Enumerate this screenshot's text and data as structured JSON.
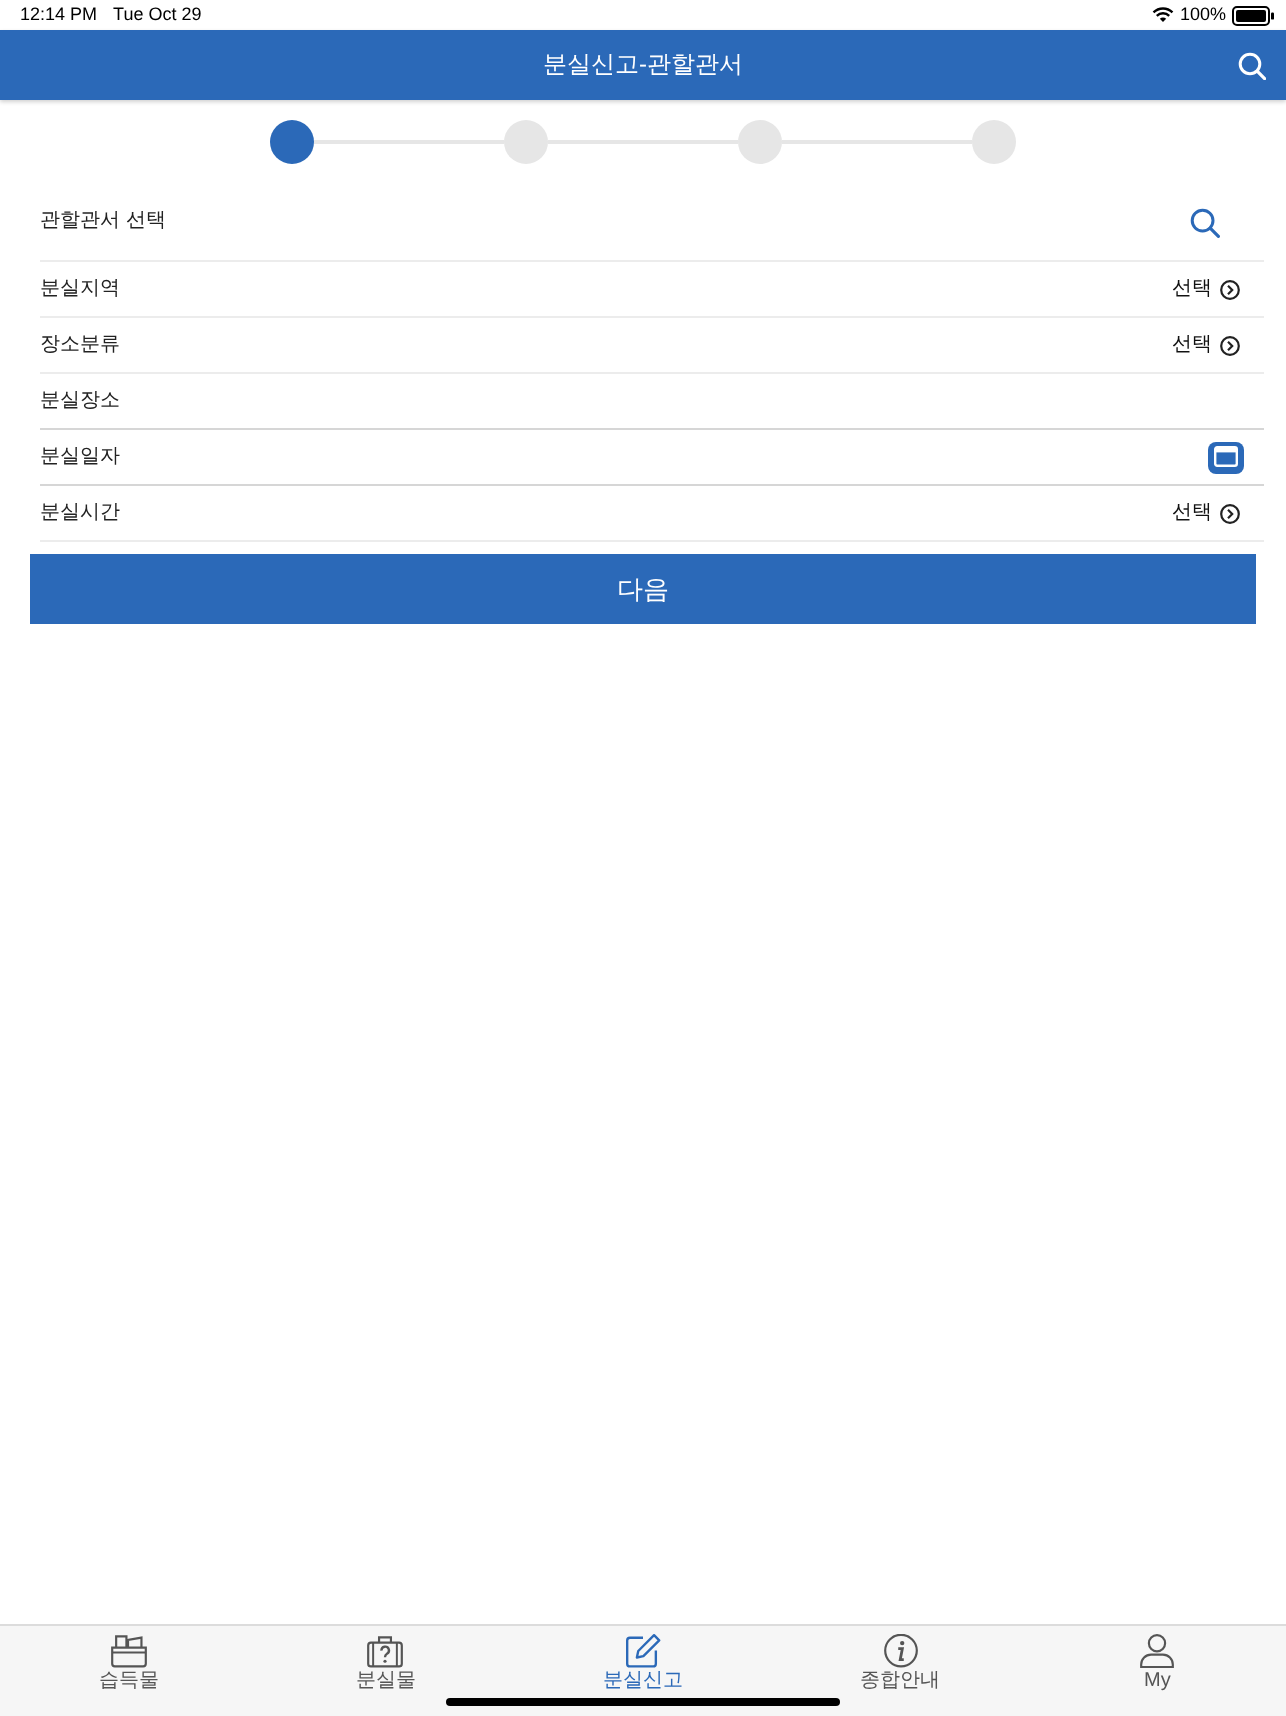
{
  "status_bar": {
    "time": "12:14 PM",
    "date": "Tue Oct 29",
    "battery": "100%"
  },
  "nav_bar": {
    "title": "분실신고-관할관서"
  },
  "steps": [
    {
      "selected": true
    },
    {
      "selected": false
    },
    {
      "selected": false
    },
    {
      "selected": false
    }
  ],
  "form_rows": [
    {
      "kind": "search",
      "label": "관할관서 선택"
    },
    {
      "kind": "select",
      "label": "분실지역",
      "action": "선택"
    },
    {
      "kind": "select",
      "label": "장소분류",
      "action": "선택"
    },
    {
      "kind": "text",
      "label": "분실장소"
    },
    {
      "kind": "date",
      "label": "분실일자"
    },
    {
      "kind": "select",
      "label": "분실시간",
      "action": "선택"
    }
  ],
  "next_button": {
    "label": "다음"
  },
  "tab_bar": [
    {
      "label": "습득물",
      "selected": false
    },
    {
      "label": "분실물",
      "selected": false
    },
    {
      "label": "분실신고",
      "selected": true
    },
    {
      "label": "종합안내",
      "selected": false
    },
    {
      "label": "My",
      "selected": false
    }
  ]
}
